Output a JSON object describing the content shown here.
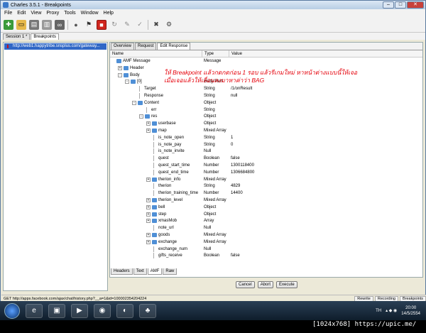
{
  "window": {
    "title": "Charles 3.5.1 - Breakpoints",
    "buttons": [
      "–",
      "□",
      "✕"
    ]
  },
  "menu": [
    "File",
    "Edit",
    "View",
    "Proxy",
    "Tools",
    "Window",
    "Help"
  ],
  "session_tabs": [
    {
      "label": "Session 1 *",
      "active": false
    },
    {
      "label": "Breakpoints",
      "active": true
    }
  ],
  "left_panel": {
    "selected_url": "http://web1.happytribe.snsplus.com/gateway..."
  },
  "right_tabs": [
    {
      "label": "Overview",
      "active": false
    },
    {
      "label": "Request",
      "active": false
    },
    {
      "label": "Edit Response",
      "active": true
    }
  ],
  "columns": [
    "Name",
    "Type",
    "Value"
  ],
  "overlay_text": [
    "ให้ Breakpoint แล้วกดกดก่อน 1 รอบ แล้วรีเกมใหม่ หาหน้าต่างแบบนี้ให้เจอ",
    "เมื่อเจอแล้วให้เลื่อนลงมาหาค่าว่า BAG"
  ],
  "tree": [
    {
      "name": "AMF Message",
      "type": "Message",
      "value": "",
      "depth": 0,
      "kind": "folder",
      "exp": ""
    },
    {
      "name": "Header",
      "type": "",
      "value": "",
      "depth": 1,
      "kind": "folder",
      "exp": "+"
    },
    {
      "name": "Body",
      "type": "",
      "value": "",
      "depth": 1,
      "kind": "folder",
      "exp": "-"
    },
    {
      "name": "[0]",
      "type": "Body Part",
      "value": "",
      "depth": 2,
      "kind": "folder",
      "exp": "-"
    },
    {
      "name": "Target",
      "type": "String",
      "value": "/1/onResult",
      "depth": 3,
      "kind": "leaf",
      "exp": ""
    },
    {
      "name": "Response",
      "type": "String",
      "value": "null",
      "depth": 3,
      "kind": "leaf",
      "exp": ""
    },
    {
      "name": "Content",
      "type": "Object",
      "value": "",
      "depth": 3,
      "kind": "folder",
      "exp": "-"
    },
    {
      "name": "err",
      "type": "String",
      "value": "",
      "depth": 4,
      "kind": "leaf",
      "exp": ""
    },
    {
      "name": "res",
      "type": "Object",
      "value": "",
      "depth": 4,
      "kind": "folder",
      "exp": "-"
    },
    {
      "name": "userbase",
      "type": "Object",
      "value": "",
      "depth": 5,
      "kind": "folder",
      "exp": "+"
    },
    {
      "name": "map",
      "type": "Mixed Array",
      "value": "",
      "depth": 5,
      "kind": "folder",
      "exp": "+"
    },
    {
      "name": "is_note_open",
      "type": "String",
      "value": "1",
      "depth": 5,
      "kind": "leaf",
      "exp": ""
    },
    {
      "name": "is_note_pay",
      "type": "String",
      "value": "0",
      "depth": 5,
      "kind": "leaf",
      "exp": ""
    },
    {
      "name": "is_note_invite",
      "type": "Null",
      "value": "",
      "depth": 5,
      "kind": "leaf",
      "exp": ""
    },
    {
      "name": "quest",
      "type": "Boolean",
      "value": "false",
      "depth": 5,
      "kind": "leaf",
      "exp": ""
    },
    {
      "name": "quest_start_time",
      "type": "Number",
      "value": "1300118400",
      "depth": 5,
      "kind": "leaf",
      "exp": ""
    },
    {
      "name": "quest_end_time",
      "type": "Number",
      "value": "1306684800",
      "depth": 5,
      "kind": "leaf",
      "exp": ""
    },
    {
      "name": "therion_info",
      "type": "Mixed Array",
      "value": "",
      "depth": 5,
      "kind": "folder",
      "exp": "+"
    },
    {
      "name": "therion",
      "type": "String",
      "value": "4829",
      "depth": 5,
      "kind": "leaf",
      "exp": ""
    },
    {
      "name": "therion_training_time",
      "type": "Number",
      "value": "14400",
      "depth": 5,
      "kind": "leaf",
      "exp": ""
    },
    {
      "name": "therion_level",
      "type": "Mixed Array",
      "value": "",
      "depth": 5,
      "kind": "folder",
      "exp": "+"
    },
    {
      "name": "bell",
      "type": "Object",
      "value": "",
      "depth": 5,
      "kind": "folder",
      "exp": "+"
    },
    {
      "name": "step",
      "type": "Object",
      "value": "",
      "depth": 5,
      "kind": "folder",
      "exp": "+"
    },
    {
      "name": "xmasMob",
      "type": "Array",
      "value": "",
      "depth": 5,
      "kind": "folder",
      "exp": "+"
    },
    {
      "name": "note_url",
      "type": "Null",
      "value": "",
      "depth": 5,
      "kind": "leaf",
      "exp": ""
    },
    {
      "name": "goods",
      "type": "Mixed Array",
      "value": "",
      "depth": 5,
      "kind": "folder",
      "exp": "+"
    },
    {
      "name": "exchange",
      "type": "Mixed Array",
      "value": "",
      "depth": 5,
      "kind": "folder",
      "exp": "+"
    },
    {
      "name": "exchange_num",
      "type": "Null",
      "value": "",
      "depth": 5,
      "kind": "leaf",
      "exp": ""
    },
    {
      "name": "gifts_receive",
      "type": "Boolean",
      "value": "false",
      "depth": 5,
      "kind": "leaf",
      "exp": ""
    }
  ],
  "bottom_tabs": [
    {
      "label": "Headers",
      "active": false
    },
    {
      "label": "Text",
      "active": false
    },
    {
      "label": "AMF",
      "active": true
    },
    {
      "label": "Raw",
      "active": false
    }
  ],
  "actions": [
    "Cancel",
    "Abort",
    "Execute"
  ],
  "status": {
    "url": "GET http://apps.facebook.com/ajax/chat/history.php?__a=1&id=100002354204224",
    "buttons": [
      "Rewrite",
      "Recording",
      "Breakpoints"
    ]
  },
  "taskbar": {
    "lang": "TH",
    "time": "20:00",
    "date": "14/5/2554"
  },
  "footer": "[1024x768] https://upic.me/"
}
